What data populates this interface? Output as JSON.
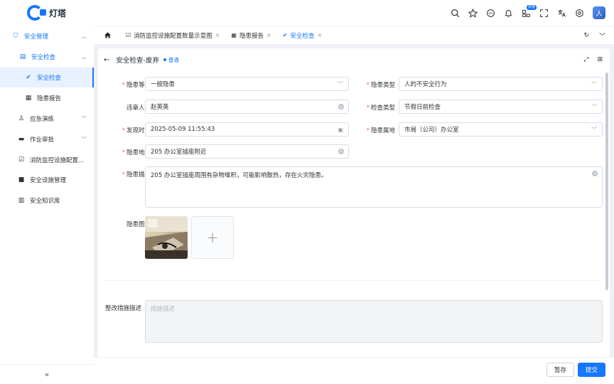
{
  "app": {
    "logo_text": "灯塔"
  },
  "header": {
    "badge_text": "日常",
    "avatar_initial": "人",
    "icons": [
      "search-icon",
      "star-icon",
      "message-icon",
      "bell-icon",
      "apps-icon",
      "fullscreen-icon",
      "translate-icon",
      "settings-icon"
    ]
  },
  "sidebar": {
    "items": [
      {
        "label": "安全管理"
      },
      {
        "label": "安全检查"
      },
      {
        "label": "安全检查"
      },
      {
        "label": "隐患报告"
      },
      {
        "label": "应急演练"
      },
      {
        "label": "作业审批"
      },
      {
        "label": "消防监控设施配置..."
      },
      {
        "label": "安全设施管理"
      },
      {
        "label": "安全知识库"
      }
    ],
    "collapse_label": "«"
  },
  "tabs": [
    {
      "label": "消防监控设施配置数量示意图"
    },
    {
      "label": "隐患报告"
    },
    {
      "label": "安全检查"
    }
  ],
  "panel": {
    "title": "安全检查-废弃",
    "status": "普通"
  },
  "form": {
    "hazard_level": {
      "label": "隐患等级",
      "value": "一般隐患"
    },
    "hazard_type": {
      "label": "隐患类型",
      "value": "人的不安全行为"
    },
    "violator": {
      "label": "违章人员",
      "value": "赵英英"
    },
    "check_type": {
      "label": "检查类型",
      "value": "节假日前检查"
    },
    "found_time": {
      "label": "发现时间",
      "value": "2025-05-09 11:55:43"
    },
    "hazard_area": {
      "label": "隐患属地",
      "value": "市局（公司）办公室"
    },
    "hazard_location": {
      "label": "隐患地点",
      "value": "205 办公室插座附近"
    },
    "hazard_desc": {
      "label": "隐患描述",
      "value": "205 办公室插座周围有杂物堆积，可能影响散热，存在火灾隐患。"
    },
    "hazard_images": {
      "label": "隐患图片",
      "add_symbol": "+"
    },
    "rectify_desc": {
      "label": "整改措施描述",
      "placeholder": "措施描述"
    }
  },
  "footer": {
    "save_label": "暂存",
    "submit_label": "提交"
  },
  "colors": {
    "accent": "#1677ff",
    "required": "#f56c6c"
  }
}
